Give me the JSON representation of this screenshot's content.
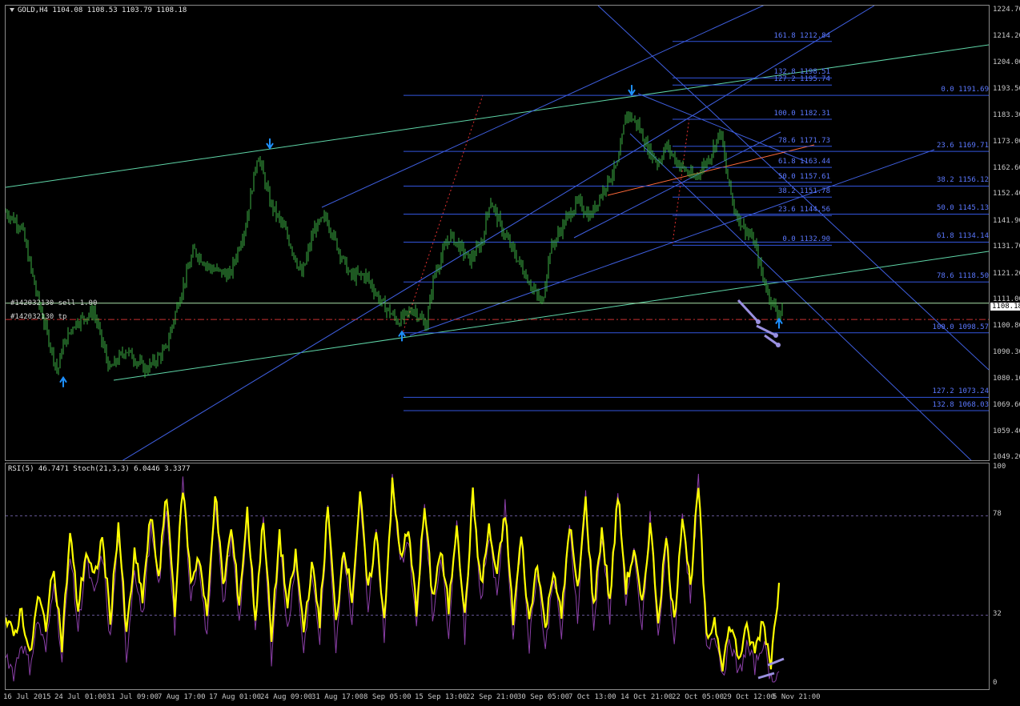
{
  "header": {
    "symbol_line": "GOLD,H4  1104.08 1108.53 1103.79 1108.18",
    "indicator_line": "RSI(5) 46.7471  Stoch(21,3,3) 6.0446 3.3377"
  },
  "trades": {
    "sell_label": "#142032130 sell 1.00",
    "tp_label": "#142032130 tp"
  },
  "current_price": "1108.18",
  "colors": {
    "background": "#000000",
    "candle": "#3cb043",
    "rsi": "#ffff00",
    "stoch": "#8b3fa8",
    "fib": "#3355dd",
    "channel_green": "#5fd6a8",
    "channel_blue": "#3f5fe0",
    "trade_line": "#a8e0a8",
    "tp_line": "#c83030",
    "arrow": "#1e90ff"
  },
  "chart_data": [
    {
      "type": "candlestick",
      "title": "GOLD,H4",
      "ylim": [
        1049.2,
        1224.7
      ],
      "yticks": [
        "1224.70",
        "1214.20",
        "1204.00",
        "1193.50",
        "1183.30",
        "1173.00",
        "1162.60",
        "1152.40",
        "1141.90",
        "1131.70",
        "1121.20",
        "1111.00",
        "1100.80",
        "1090.30",
        "1080.10",
        "1069.60",
        "1059.40",
        "1049.20"
      ],
      "close_path": [
        [
          0,
          1146
        ],
        [
          20,
          1140
        ],
        [
          40,
          1112
        ],
        [
          65,
          1083
        ],
        [
          70,
          1092
        ],
        [
          85,
          1102
        ],
        [
          110,
          1107
        ],
        [
          130,
          1084
        ],
        [
          150,
          1092
        ],
        [
          175,
          1084
        ],
        [
          200,
          1092
        ],
        [
          215,
          1110
        ],
        [
          235,
          1131
        ],
        [
          255,
          1124
        ],
        [
          280,
          1121
        ],
        [
          300,
          1141
        ],
        [
          315,
          1169
        ],
        [
          330,
          1150
        ],
        [
          350,
          1138
        ],
        [
          370,
          1121
        ],
        [
          385,
          1139
        ],
        [
          400,
          1144
        ],
        [
          415,
          1132
        ],
        [
          430,
          1121
        ],
        [
          450,
          1121
        ],
        [
          470,
          1110
        ],
        [
          490,
          1103
        ],
        [
          510,
          1108
        ],
        [
          525,
          1101
        ],
        [
          535,
          1121
        ],
        [
          555,
          1137
        ],
        [
          580,
          1127
        ],
        [
          595,
          1134
        ],
        [
          605,
          1151
        ],
        [
          620,
          1139
        ],
        [
          640,
          1127
        ],
        [
          660,
          1115
        ],
        [
          670,
          1110
        ],
        [
          680,
          1131
        ],
        [
          700,
          1143
        ],
        [
          715,
          1150
        ],
        [
          730,
          1144
        ],
        [
          750,
          1157
        ],
        [
          765,
          1165
        ],
        [
          775,
          1185
        ],
        [
          790,
          1180
        ],
        [
          800,
          1172
        ],
        [
          815,
          1165
        ],
        [
          825,
          1172
        ],
        [
          840,
          1165
        ],
        [
          860,
          1159
        ],
        [
          880,
          1168
        ],
        [
          893,
          1178
        ],
        [
          900,
          1162
        ],
        [
          910,
          1147
        ],
        [
          920,
          1141
        ],
        [
          935,
          1134
        ],
        [
          945,
          1121
        ],
        [
          955,
          1112
        ],
        [
          965,
          1106
        ],
        [
          970,
          1108
        ]
      ],
      "arrows": [
        {
          "dir": "up",
          "x": 72,
          "price": 1081
        },
        {
          "dir": "down",
          "x": 330,
          "price": 1171
        },
        {
          "dir": "up",
          "x": 495,
          "price": 1099
        },
        {
          "dir": "down",
          "x": 782,
          "price": 1192
        },
        {
          "dir": "up",
          "x": 966,
          "price": 1104
        }
      ],
      "fib_right": [
        {
          "label": "0.0 1191.69",
          "price": 1191.69
        },
        {
          "label": "23.6 1169.71",
          "price": 1169.71
        },
        {
          "label": "38.2 1156.12",
          "price": 1156.12
        },
        {
          "label": "50.0 1145.13",
          "price": 1145.13
        },
        {
          "label": "61.8 1134.14",
          "price": 1134.14
        },
        {
          "label": "78.6 1118.50",
          "price": 1118.5
        },
        {
          "label": "100.0 1098.57",
          "price": 1098.57
        },
        {
          "label": "127.2 1073.24",
          "price": 1073.24
        },
        {
          "label": "132.8 1068.03",
          "price": 1068.03
        }
      ],
      "fib_mid": [
        {
          "label": "161.8 1212.84",
          "price": 1212.84
        },
        {
          "label": "132.8 1198.51",
          "price": 1198.51
        },
        {
          "label": "127.2 1195.74",
          "price": 1195.74
        },
        {
          "label": "100.0 1182.31",
          "price": 1182.31
        },
        {
          "label": "78.6 1171.73",
          "price": 1171.73
        },
        {
          "label": "61.8 1163.44",
          "price": 1163.44
        },
        {
          "label": "50.0 1157.61",
          "price": 1157.61
        },
        {
          "label": "38.2 1151.78",
          "price": 1151.78
        },
        {
          "label": "23.6 1144.56",
          "price": 1144.56
        },
        {
          "label": "0.0 1132.90",
          "price": 1132.9
        }
      ],
      "sell_price": 1110.2,
      "tp_price": 1103.8
    },
    {
      "type": "line",
      "title": "RSI(5) / Stoch(21,3,3)",
      "ylim": [
        0,
        100
      ],
      "yticks": [
        "100",
        "78",
        "32",
        "0"
      ],
      "levels": [
        78,
        32
      ],
      "series": [
        {
          "name": "RSI(5)",
          "values": [
            30,
            22,
            35,
            12,
            40,
            28,
            55,
            18,
            70,
            35,
            62,
            48,
            68,
            30,
            75,
            22,
            60,
            40,
            78,
            50,
            88,
            35,
            92,
            48,
            60,
            30,
            90,
            45,
            72,
            38,
            80,
            30,
            78,
            20,
            70,
            35,
            60,
            25,
            55,
            30,
            82,
            28,
            65,
            40,
            88,
            42,
            70,
            30,
            92,
            60,
            70,
            35,
            82,
            40,
            62,
            35,
            76,
            30,
            88,
            45,
            72,
            50,
            80,
            30,
            68,
            28,
            58,
            25,
            55,
            30,
            75,
            42,
            85,
            35,
            72,
            38,
            88,
            45,
            62,
            35,
            75,
            30,
            68,
            28,
            80,
            45,
            92,
            20,
            30,
            10,
            28,
            12,
            25,
            15,
            30,
            10,
            47
          ]
        },
        {
          "name": "Stoch(21,3,3)",
          "values": [
            15,
            5,
            20,
            8,
            30,
            15,
            50,
            10,
            62,
            25,
            58,
            40,
            60,
            20,
            70,
            12,
            55,
            30,
            72,
            45,
            82,
            25,
            95,
            40,
            58,
            20,
            88,
            35,
            70,
            28,
            78,
            22,
            80,
            12,
            68,
            25,
            58,
            15,
            52,
            20,
            80,
            18,
            62,
            30,
            90,
            35,
            72,
            20,
            95,
            55,
            68,
            25,
            85,
            30,
            60,
            25,
            78,
            20,
            90,
            38,
            70,
            42,
            82,
            20,
            70,
            18,
            55,
            15,
            52,
            22,
            72,
            32,
            88,
            25,
            70,
            30,
            92,
            38,
            60,
            25,
            78,
            20,
            65,
            18,
            82,
            38,
            95,
            15,
            25,
            5,
            20,
            4,
            18,
            8,
            20,
            3,
            6
          ]
        }
      ]
    }
  ],
  "xaxis_labels": [
    "16 Jul 2015",
    "24 Jul 01:00",
    "31 Jul 09:00",
    "7 Aug 17:00",
    "17 Aug 01:00",
    "24 Aug 09:00",
    "31 Aug 17:00",
    "8 Sep 05:00",
    "15 Sep 13:00",
    "22 Sep 21:00",
    "30 Sep 05:00",
    "7 Oct 13:00",
    "14 Oct 21:00",
    "22 Oct 05:00",
    "29 Oct 12:00",
    "5 Nov 21:00"
  ]
}
